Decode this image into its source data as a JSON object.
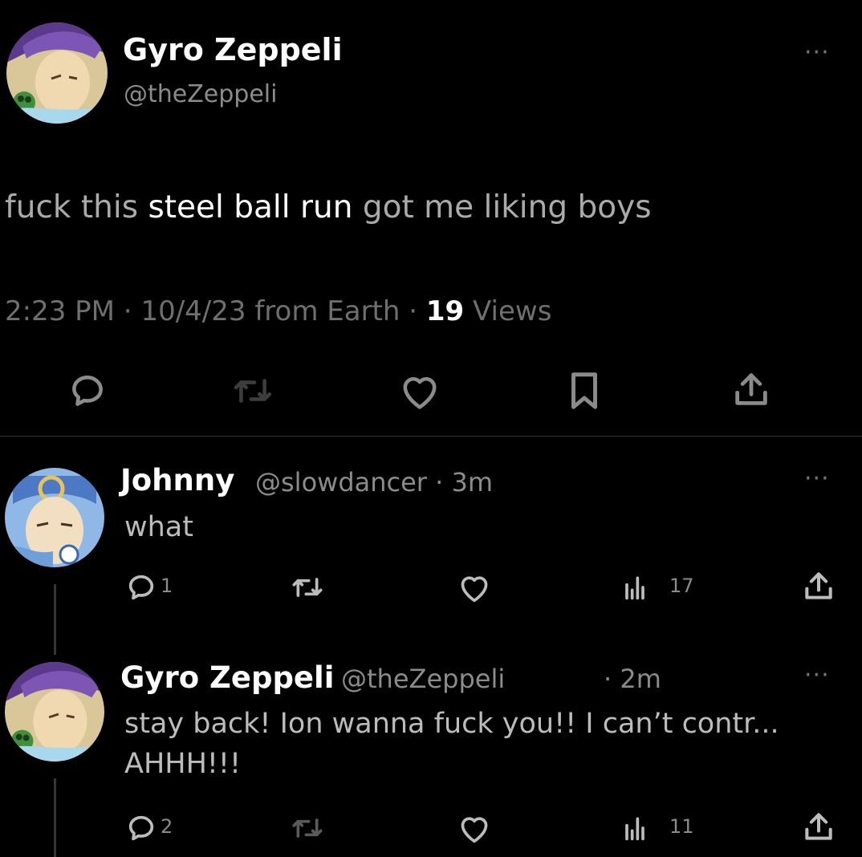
{
  "main_tweet": {
    "display_name": "Gyro Zeppeli",
    "handle": "@theZeppeli",
    "more": "···",
    "text_before": "fuck this ",
    "text_highlight": "steel ball run",
    "text_after": " got me liking boys",
    "time": "2:23 PM",
    "separator_1": " · ",
    "date": "10/4/23",
    "source": " from Earth",
    "separator_2": " · ",
    "views_count": "19",
    "views_label": " Views",
    "actions": [
      "reply-icon",
      "retweet-icon",
      "like-icon",
      "bookmark-icon",
      "share-icon"
    ]
  },
  "replies": [
    {
      "display_name": "Johnny",
      "handle": "@slowdancer",
      "time_sep": " · ",
      "time": "3m",
      "text_lines": [
        "what"
      ],
      "more": "···",
      "reply_count": "1",
      "views_count": "17"
    },
    {
      "display_name": "Gyro Zeppeli",
      "handle": "@theZeppeli",
      "time_sep": " · ",
      "time": "2m",
      "text_lines": [
        "stay back! Ion wanna fuck you!! I can’t contr...",
        "AHHH!!!"
      ],
      "more": "···",
      "reply_count": "2",
      "views_count": "11"
    }
  ],
  "colors": {
    "background": "#000000",
    "primary_text": "#e7e9ea",
    "secondary_text": "#71767b",
    "divider": "#2f3336"
  }
}
